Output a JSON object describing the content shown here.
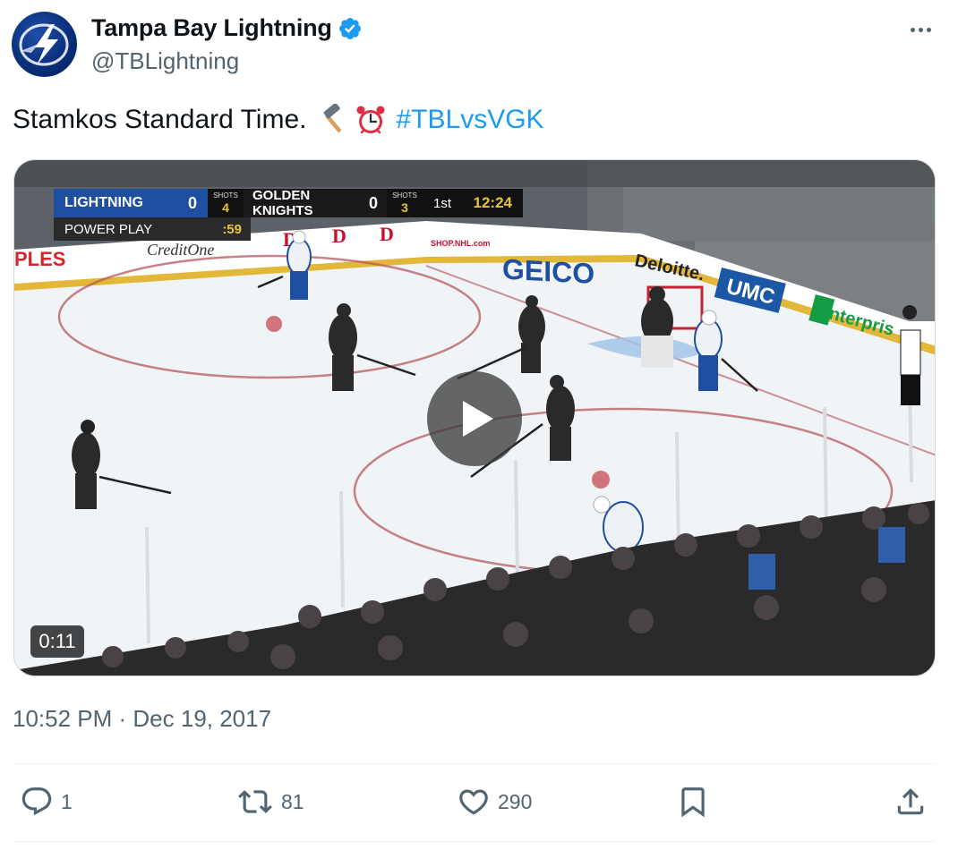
{
  "author": {
    "name": "Tampa Bay Lightning",
    "handle": "@TBLightning",
    "verified_color": "#1d9bf0"
  },
  "tweet": {
    "text": "Stamkos Standard Time.",
    "emojis": [
      "hammer-icon",
      "alarm-clock-icon"
    ],
    "hashtag": "#TBLvsVGK",
    "timestamp": "10:52 PM · Dec 19, 2017"
  },
  "video": {
    "duration": "0:11",
    "scorebug": {
      "team_a": "LIGHTNING",
      "team_a_score": "0",
      "team_a_shots_label": "SHOTS",
      "team_a_shots": "4",
      "team_b": "GOLDEN KNIGHTS",
      "team_b_score": "0",
      "team_b_shots_label": "SHOTS",
      "team_b_shots": "3",
      "period": "1st",
      "clock": "12:24",
      "power_play_label": "POWER PLAY",
      "power_play_time": ":59"
    },
    "boards": [
      "PLES",
      "CreditOne",
      "SHOP.NHL.com",
      "GEICO",
      "Deloitte.",
      "UMC",
      "enterprise"
    ]
  },
  "actions": {
    "reply_count": "1",
    "retweet_count": "81",
    "like_count": "290"
  },
  "colors": {
    "link": "#1d9bf0",
    "secondary_text": "#536471",
    "lightning_blue": "#1e4fa0",
    "clock_yellow": "#e8c23b"
  }
}
